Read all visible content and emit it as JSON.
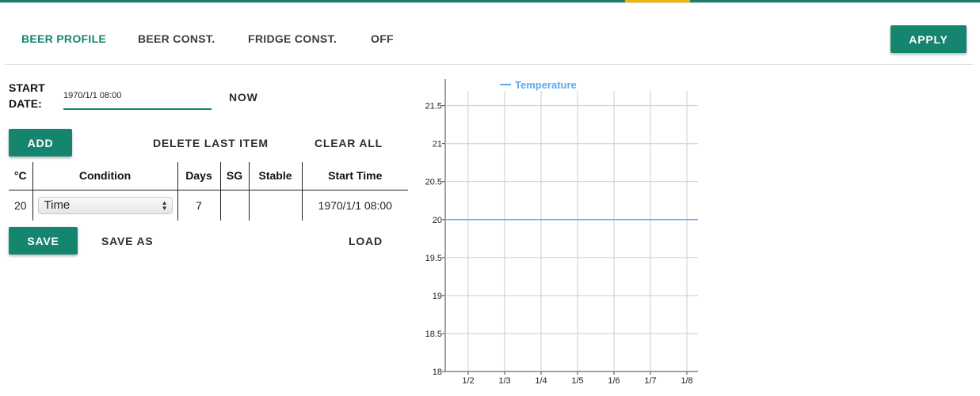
{
  "tabs": [
    {
      "label": "BEER PROFILE",
      "active": true
    },
    {
      "label": "BEER CONST.",
      "active": false
    },
    {
      "label": "FRIDGE CONST.",
      "active": false
    },
    {
      "label": "OFF",
      "active": false
    }
  ],
  "apply_label": "APPLY",
  "start_date": {
    "label_line1": "START",
    "label_line2": "DATE:",
    "value": "1970/1/1 08:00",
    "now_label": "NOW"
  },
  "actions": {
    "add": "ADD",
    "delete_last": "DELETE LAST ITEM",
    "clear_all": "CLEAR ALL"
  },
  "table": {
    "headers": [
      "°C",
      "Condition",
      "Days",
      "SG",
      "Stable",
      "Start Time"
    ],
    "rows": [
      {
        "temp": "20",
        "condition": "Time",
        "days": "7",
        "sg": "",
        "stable": "",
        "start_time": "1970/1/1 08:00"
      }
    ]
  },
  "footer_actions": {
    "save": "SAVE",
    "save_as": "SAVE AS",
    "load": "LOAD"
  },
  "colors": {
    "accent": "#15856f",
    "tab_indicator": "#f5b400",
    "series": "#5aa9ee"
  },
  "icons": {
    "select_arrows": "updown-arrows-icon"
  },
  "chart_data": {
    "type": "line",
    "legend": [
      "Temperature"
    ],
    "legend_position": "top",
    "grid": true,
    "ylim": [
      18,
      21.85
    ],
    "yticks": [
      18,
      18.5,
      19,
      19.5,
      20,
      20.5,
      21,
      21.5
    ],
    "ytick_labels": [
      "18",
      "18.5",
      "19",
      "19.5",
      "20",
      "20.5",
      "21",
      "21.5"
    ],
    "xticks": [
      "1/2",
      "1/3",
      "1/4",
      "1/5",
      "1/6",
      "1/7",
      "1/8"
    ],
    "series": [
      {
        "name": "Temperature",
        "x": [
          "1/1",
          "1/8"
        ],
        "values": [
          20,
          20
        ]
      }
    ]
  }
}
